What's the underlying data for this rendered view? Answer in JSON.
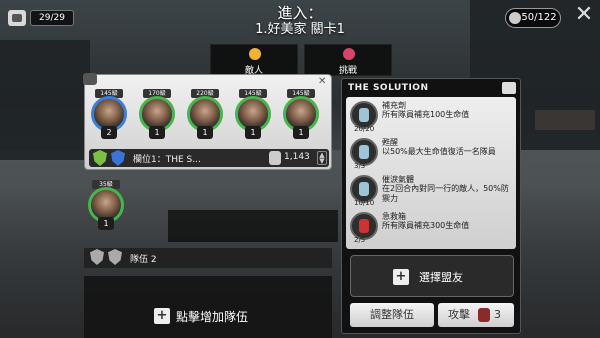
{
  "header": {
    "energy": "29/29",
    "title_line1": "進入：",
    "title_line2": "1.好美家 關卡1",
    "keys": "50/122"
  },
  "tabs": [
    {
      "label": "敵人",
      "icon": "lightning-icon"
    },
    {
      "label": "挑戰",
      "icon": "target-icon"
    }
  ],
  "team1": {
    "heroes": [
      {
        "level": "145級",
        "stars": "2",
        "ring": "blue"
      },
      {
        "level": "170級",
        "stars": "1",
        "ring": "green"
      },
      {
        "level": "220級",
        "stars": "1",
        "ring": "green"
      },
      {
        "level": "145級",
        "stars": "1",
        "ring": "green"
      },
      {
        "level": "145級",
        "stars": "1",
        "ring": "green"
      }
    ],
    "slot_label": "欄位1：THE S...",
    "power": "1,143"
  },
  "team2": {
    "hero": {
      "level": "35級",
      "stars": "1"
    },
    "label": "隊伍 2"
  },
  "add_team_label": "點擊增加隊伍",
  "panel": {
    "title": "THE SOLUTION",
    "items": [
      {
        "name": "補充劑",
        "desc": "所有隊員補充100生命值",
        "count": "20/20",
        "icon": "syringe-icon"
      },
      {
        "name": "甦醒",
        "desc": "以50%最大生命值復活一名隊員",
        "count": "3/3",
        "icon": "vial-icon"
      },
      {
        "name": "催淚氣體",
        "desc": "在2回合內對同一行的敵人，50%防禦力",
        "count": "10/10",
        "icon": "gas-grenade-icon"
      },
      {
        "name": "急救箱",
        "desc": "所有隊員補充300生命值",
        "count": "2/5",
        "icon": "medkit-icon"
      }
    ],
    "select_ally": "選擇盟友",
    "adjust_team": "調整隊伍",
    "attack": "攻擊",
    "attack_cost": "3"
  }
}
